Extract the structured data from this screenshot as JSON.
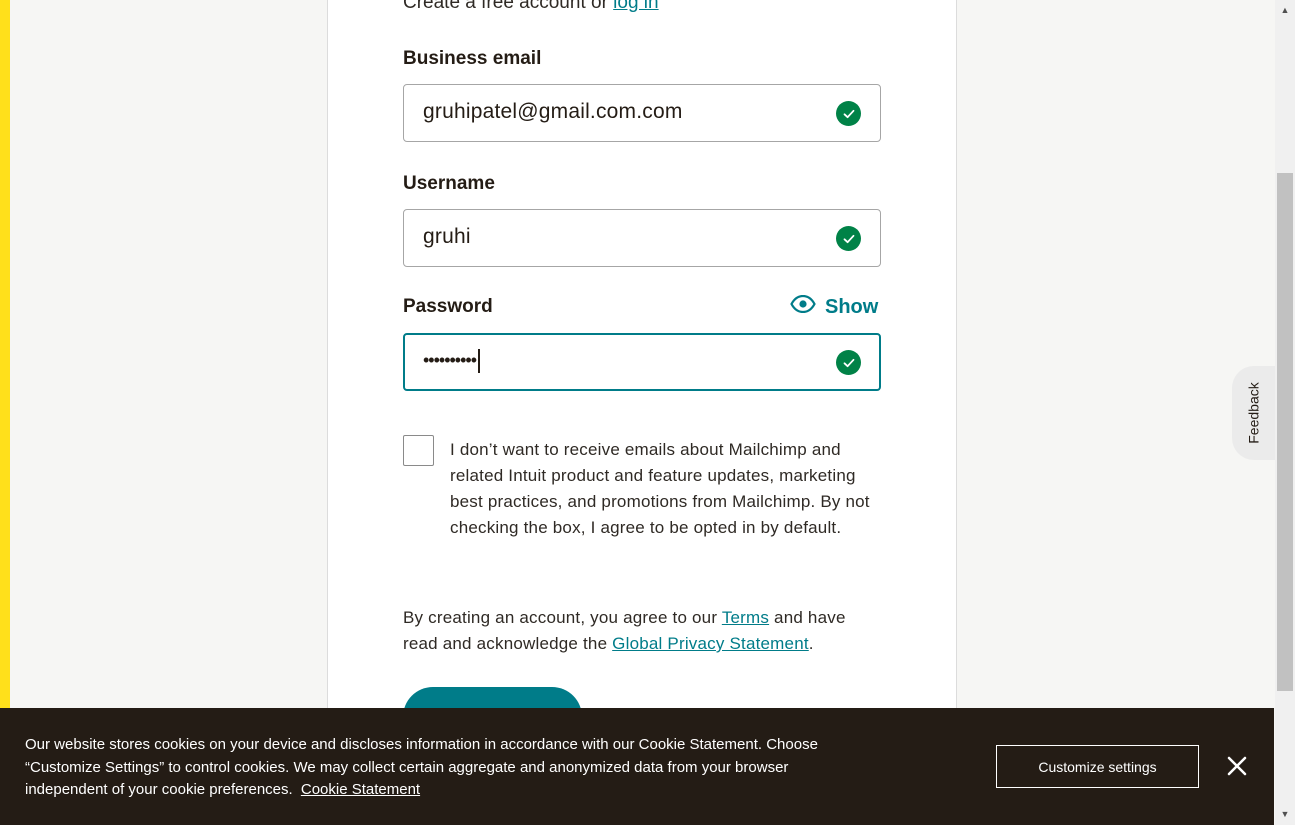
{
  "header": {
    "intro_text": "Create a free account or",
    "login_link": "log in"
  },
  "form": {
    "email": {
      "label": "Business email",
      "value": "gruhipatel@gmail.com.com"
    },
    "username": {
      "label": "Username",
      "value": "gruhi"
    },
    "password": {
      "label": "Password",
      "masked_value": "••••••••••",
      "show_label": "Show"
    },
    "opt_out_checkbox": {
      "checked": false,
      "text": "I don’t want to receive emails about Mailchimp and related Intuit product and feature updates, marketing best practices, and promotions from Mailchimp. By not checking the box, I agree to be opted in by default."
    },
    "legal": {
      "part1": "By creating an account, you agree to our",
      "terms_link": "Terms",
      "part2": "and have read and acknowledge the",
      "privacy_link": "Global Privacy Statement",
      "part3": "."
    }
  },
  "feedback": {
    "label": "Feedback"
  },
  "cookie_banner": {
    "text": "Our website stores cookies on your device and discloses information in accordance with our Cookie Statement. Choose “Customize Settings” to control cookies. We may collect certain aggregate and anonymized data from your browser independent of your cookie preferences.",
    "link": "Cookie Statement",
    "customize_label": "Customize settings"
  },
  "colors": {
    "accent": "#007c89",
    "success": "#008247",
    "brand_yellow": "#ffe01b",
    "banner_bg": "#241c15"
  },
  "icons": {
    "valid": "check-circle-icon",
    "show_password": "eye-icon",
    "close": "close-icon"
  }
}
